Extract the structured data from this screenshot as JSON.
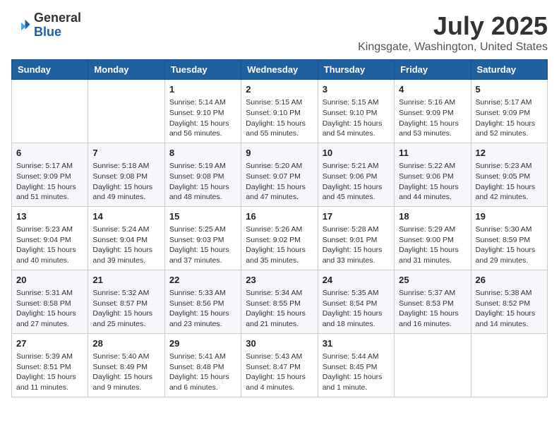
{
  "header": {
    "logo_general": "General",
    "logo_blue": "Blue",
    "month": "July 2025",
    "location": "Kingsgate, Washington, United States"
  },
  "weekdays": [
    "Sunday",
    "Monday",
    "Tuesday",
    "Wednesday",
    "Thursday",
    "Friday",
    "Saturday"
  ],
  "weeks": [
    [
      null,
      null,
      {
        "day": 1,
        "sunrise": "5:14 AM",
        "sunset": "9:10 PM",
        "daylight": "15 hours and 56 minutes."
      },
      {
        "day": 2,
        "sunrise": "5:15 AM",
        "sunset": "9:10 PM",
        "daylight": "15 hours and 55 minutes."
      },
      {
        "day": 3,
        "sunrise": "5:15 AM",
        "sunset": "9:10 PM",
        "daylight": "15 hours and 54 minutes."
      },
      {
        "day": 4,
        "sunrise": "5:16 AM",
        "sunset": "9:09 PM",
        "daylight": "15 hours and 53 minutes."
      },
      {
        "day": 5,
        "sunrise": "5:17 AM",
        "sunset": "9:09 PM",
        "daylight": "15 hours and 52 minutes."
      }
    ],
    [
      {
        "day": 6,
        "sunrise": "5:17 AM",
        "sunset": "9:09 PM",
        "daylight": "15 hours and 51 minutes."
      },
      {
        "day": 7,
        "sunrise": "5:18 AM",
        "sunset": "9:08 PM",
        "daylight": "15 hours and 49 minutes."
      },
      {
        "day": 8,
        "sunrise": "5:19 AM",
        "sunset": "9:08 PM",
        "daylight": "15 hours and 48 minutes."
      },
      {
        "day": 9,
        "sunrise": "5:20 AM",
        "sunset": "9:07 PM",
        "daylight": "15 hours and 47 minutes."
      },
      {
        "day": 10,
        "sunrise": "5:21 AM",
        "sunset": "9:06 PM",
        "daylight": "15 hours and 45 minutes."
      },
      {
        "day": 11,
        "sunrise": "5:22 AM",
        "sunset": "9:06 PM",
        "daylight": "15 hours and 44 minutes."
      },
      {
        "day": 12,
        "sunrise": "5:23 AM",
        "sunset": "9:05 PM",
        "daylight": "15 hours and 42 minutes."
      }
    ],
    [
      {
        "day": 13,
        "sunrise": "5:23 AM",
        "sunset": "9:04 PM",
        "daylight": "15 hours and 40 minutes."
      },
      {
        "day": 14,
        "sunrise": "5:24 AM",
        "sunset": "9:04 PM",
        "daylight": "15 hours and 39 minutes."
      },
      {
        "day": 15,
        "sunrise": "5:25 AM",
        "sunset": "9:03 PM",
        "daylight": "15 hours and 37 minutes."
      },
      {
        "day": 16,
        "sunrise": "5:26 AM",
        "sunset": "9:02 PM",
        "daylight": "15 hours and 35 minutes."
      },
      {
        "day": 17,
        "sunrise": "5:28 AM",
        "sunset": "9:01 PM",
        "daylight": "15 hours and 33 minutes."
      },
      {
        "day": 18,
        "sunrise": "5:29 AM",
        "sunset": "9:00 PM",
        "daylight": "15 hours and 31 minutes."
      },
      {
        "day": 19,
        "sunrise": "5:30 AM",
        "sunset": "8:59 PM",
        "daylight": "15 hours and 29 minutes."
      }
    ],
    [
      {
        "day": 20,
        "sunrise": "5:31 AM",
        "sunset": "8:58 PM",
        "daylight": "15 hours and 27 minutes."
      },
      {
        "day": 21,
        "sunrise": "5:32 AM",
        "sunset": "8:57 PM",
        "daylight": "15 hours and 25 minutes."
      },
      {
        "day": 22,
        "sunrise": "5:33 AM",
        "sunset": "8:56 PM",
        "daylight": "15 hours and 23 minutes."
      },
      {
        "day": 23,
        "sunrise": "5:34 AM",
        "sunset": "8:55 PM",
        "daylight": "15 hours and 21 minutes."
      },
      {
        "day": 24,
        "sunrise": "5:35 AM",
        "sunset": "8:54 PM",
        "daylight": "15 hours and 18 minutes."
      },
      {
        "day": 25,
        "sunrise": "5:37 AM",
        "sunset": "8:53 PM",
        "daylight": "15 hours and 16 minutes."
      },
      {
        "day": 26,
        "sunrise": "5:38 AM",
        "sunset": "8:52 PM",
        "daylight": "15 hours and 14 minutes."
      }
    ],
    [
      {
        "day": 27,
        "sunrise": "5:39 AM",
        "sunset": "8:51 PM",
        "daylight": "15 hours and 11 minutes."
      },
      {
        "day": 28,
        "sunrise": "5:40 AM",
        "sunset": "8:49 PM",
        "daylight": "15 hours and 9 minutes."
      },
      {
        "day": 29,
        "sunrise": "5:41 AM",
        "sunset": "8:48 PM",
        "daylight": "15 hours and 6 minutes."
      },
      {
        "day": 30,
        "sunrise": "5:43 AM",
        "sunset": "8:47 PM",
        "daylight": "15 hours and 4 minutes."
      },
      {
        "day": 31,
        "sunrise": "5:44 AM",
        "sunset": "8:45 PM",
        "daylight": "15 hours and 1 minute."
      },
      null,
      null
    ]
  ]
}
